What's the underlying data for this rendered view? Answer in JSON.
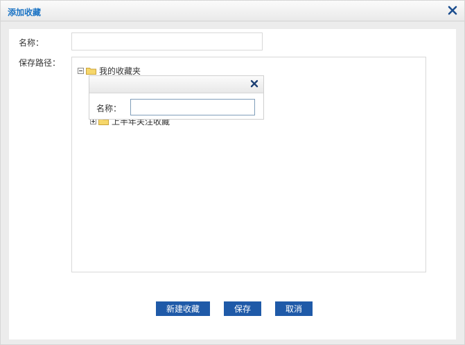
{
  "dialog": {
    "title": "添加收藏"
  },
  "form": {
    "name_label": "名称：",
    "name_value": "",
    "path_label": "保存路径："
  },
  "tree": {
    "root": {
      "label": "我的收藏夹",
      "expanded": true
    },
    "child": {
      "label": "上半年关注收藏",
      "expanded": false
    }
  },
  "subdialog": {
    "name_label": "名称：",
    "name_value": ""
  },
  "buttons": {
    "new_label": "新建收藏",
    "save_label": "保存",
    "cancel_label": "取消"
  },
  "colors": {
    "title_text": "#1a73c4",
    "button_bg": "#1f5aa8",
    "close_icon": "#1c4e8f",
    "folder_fill": "#f6d76b"
  }
}
